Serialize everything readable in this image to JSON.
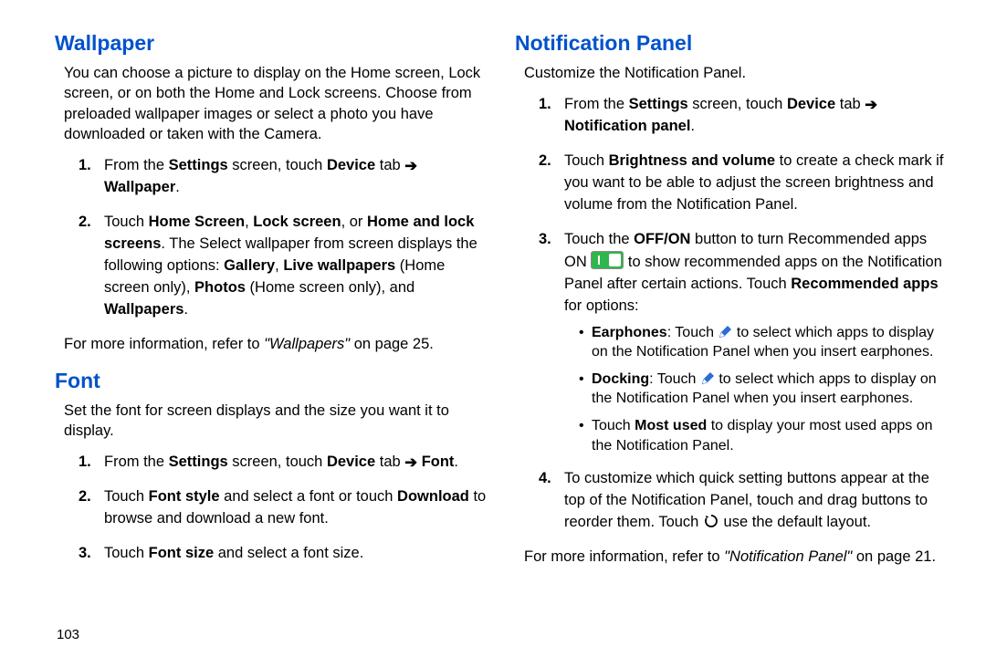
{
  "page_number": "103",
  "left": {
    "wallpaper": {
      "heading": "Wallpaper",
      "intro": "You can choose a picture to display on the Home screen, Lock screen, or on both the Home and Lock screens. Choose from preloaded wallpaper images or select a photo you have downloaded or taken with the Camera.",
      "step1_pre": "From the ",
      "step1_settings": "Settings",
      "step1_mid": " screen, touch ",
      "step1_device": "Device",
      "step1_tab": " tab ",
      "step1_wallpaper": "Wallpaper",
      "step1_end": ".",
      "step2_a": "Touch ",
      "step2_home": "Home Screen",
      "step2_comma1": ", ",
      "step2_lock": "Lock screen",
      "step2_or": ", or ",
      "step2_homelock": "Home and lock screens",
      "step2_b": ". The Select wallpaper from screen displays the following options: ",
      "step2_gallery": "Gallery",
      "step2_comma2": ", ",
      "step2_live": "Live wallpapers",
      "step2_c": " (Home screen only), ",
      "step2_photos": "Photos",
      "step2_d": " (Home screen only), and ",
      "step2_wallpapers": "Wallpapers",
      "step2_e": ".",
      "ref_a": "For more information, refer to ",
      "ref_q": "\"Wallpapers\"",
      "ref_b": " on page 25."
    },
    "font": {
      "heading": "Font",
      "intro": "Set the font for screen displays and the size you want it to display.",
      "step1_pre": "From the ",
      "step1_settings": "Settings",
      "step1_mid": " screen, touch ",
      "step1_device": "Device",
      "step1_tab": " tab ",
      "step1_font": "Font",
      "step1_end": ".",
      "step2_a": "Touch ",
      "step2_style": "Font style",
      "step2_b": " and select a font or touch ",
      "step2_download": "Download",
      "step2_c": " to browse and download a new font.",
      "step3_a": "Touch ",
      "step3_size": "Font size",
      "step3_b": " and select a font size."
    }
  },
  "right": {
    "heading": "Notification Panel",
    "intro": "Customize the Notification Panel.",
    "step1_pre": "From the ",
    "step1_settings": "Settings",
    "step1_mid": " screen, touch ",
    "step1_device": "Device",
    "step1_tab": " tab ",
    "step1_np": "Notification panel",
    "step1_end": ".",
    "step2_a": "Touch ",
    "step2_bv": "Brightness and volume",
    "step2_b": " to create a check mark if you want to be able to adjust the screen brightness and volume from the Notification Panel.",
    "step3_a": "Touch the ",
    "step3_offon": "OFF/ON",
    "step3_b": " button to turn Recommended apps ON ",
    "step3_c": " to show recommended apps on the Notification Panel after certain actions. Touch ",
    "step3_ra": "Recommended apps",
    "step3_d": " for options:",
    "bullet1_ear": "Earphones",
    "bullet1_a": ": Touch ",
    "bullet1_b": " to select which apps to display on the Notification Panel when you insert earphones.",
    "bullet2_dock": "Docking",
    "bullet2_a": ": Touch ",
    "bullet2_b": " to select which apps to display on the Notification Panel when you insert earphones.",
    "bullet3_a": "Touch ",
    "bullet3_mu": "Most used",
    "bullet3_b": " to display your most used apps on the Notification Panel.",
    "step4_a": "To customize which quick setting buttons appear at the top of the Notification Panel, touch and drag buttons to reorder them. Touch ",
    "step4_b": " use the default layout.",
    "ref_a": "For more information, refer to ",
    "ref_q": "\"Notification Panel\"",
    "ref_b": " on page 21."
  }
}
